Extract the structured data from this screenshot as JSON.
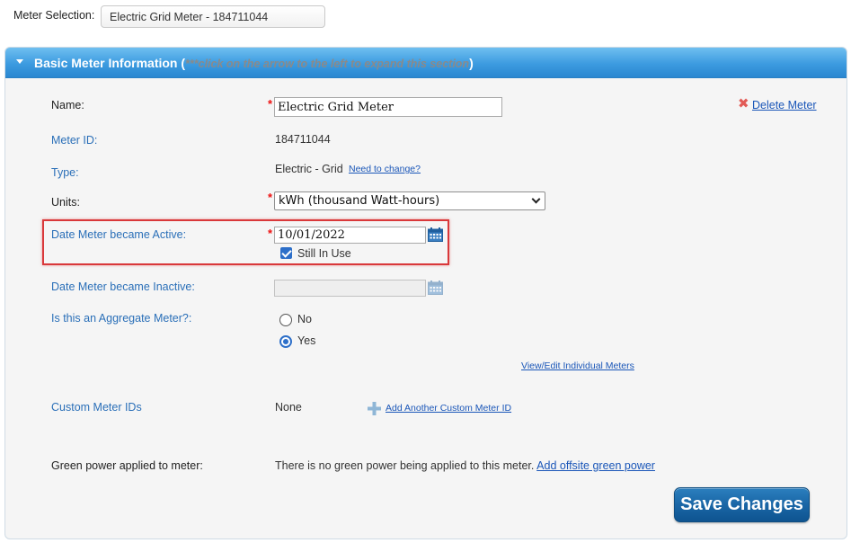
{
  "meter_selection": {
    "label": "Meter Selection:",
    "value": "Electric Grid Meter - 184711044"
  },
  "section": {
    "title": "Basic Meter Information (",
    "hint": "***click on the arrow to the left to expand this section",
    "title_close": ")"
  },
  "fields": {
    "name_label": "Name:",
    "name_value": "Electric Grid Meter",
    "meter_id_label": "Meter ID:",
    "meter_id_value": "184711044",
    "type_label": "Type:",
    "type_value": "Electric - Grid",
    "type_change_link": "Need to change?",
    "units_label": "Units:",
    "units_value": "kWh (thousand Watt-hours)",
    "active_date_label": "Date Meter became Active:",
    "active_date_value": "10/01/2022",
    "still_in_use_label": "Still In Use",
    "inactive_date_label": "Date Meter became Inactive:",
    "inactive_date_value": "",
    "aggregate_label": "Is this an Aggregate Meter?:",
    "aggregate_no": "No",
    "aggregate_yes": "Yes",
    "aggregate_selected": "Yes",
    "view_edit_link": "View/Edit Individual Meters",
    "custom_ids_label": "Custom Meter IDs",
    "custom_ids_value": "None",
    "add_custom_id_link": "Add Another Custom Meter ID",
    "green_power_label": "Green power applied to meter:",
    "green_power_text": "There is no green power being applied to this meter.",
    "add_green_power_link": "Add offsite green power"
  },
  "actions": {
    "delete_meter": "Delete Meter",
    "save_changes": "Save Changes"
  },
  "colors": {
    "header_blue": "#3c9be0",
    "label_blue": "#2a6fb8",
    "required_red": "#e11111",
    "highlight_red": "#d9383a",
    "save_button": "#1a66a6"
  }
}
